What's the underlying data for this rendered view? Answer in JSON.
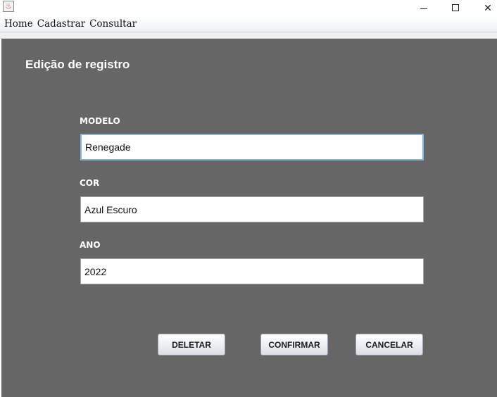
{
  "window": {
    "minimize_glyph": "",
    "close_glyph": "✕",
    "app_icon_glyph": "♨"
  },
  "menu": {
    "items": [
      "Home",
      "Cadastrar",
      "Consultar"
    ]
  },
  "form": {
    "title": "Edição de registro",
    "modelo_label": "MODELO",
    "modelo_value": "Renegade",
    "cor_label": "COR",
    "cor_value": "Azul Escuro",
    "ano_label": "ANO",
    "ano_value": "2022"
  },
  "buttons": {
    "deletar": "DELETAR",
    "confirmar": "CONFIRMAR",
    "cancelar": "CANCELAR"
  },
  "colors": {
    "panel_bg": "#666666",
    "focus_border": "#8db2d6"
  },
  "icons": {
    "app": "java-cup-icon",
    "minimize": "minimize-icon",
    "maximize": "maximize-icon",
    "close": "close-icon"
  }
}
